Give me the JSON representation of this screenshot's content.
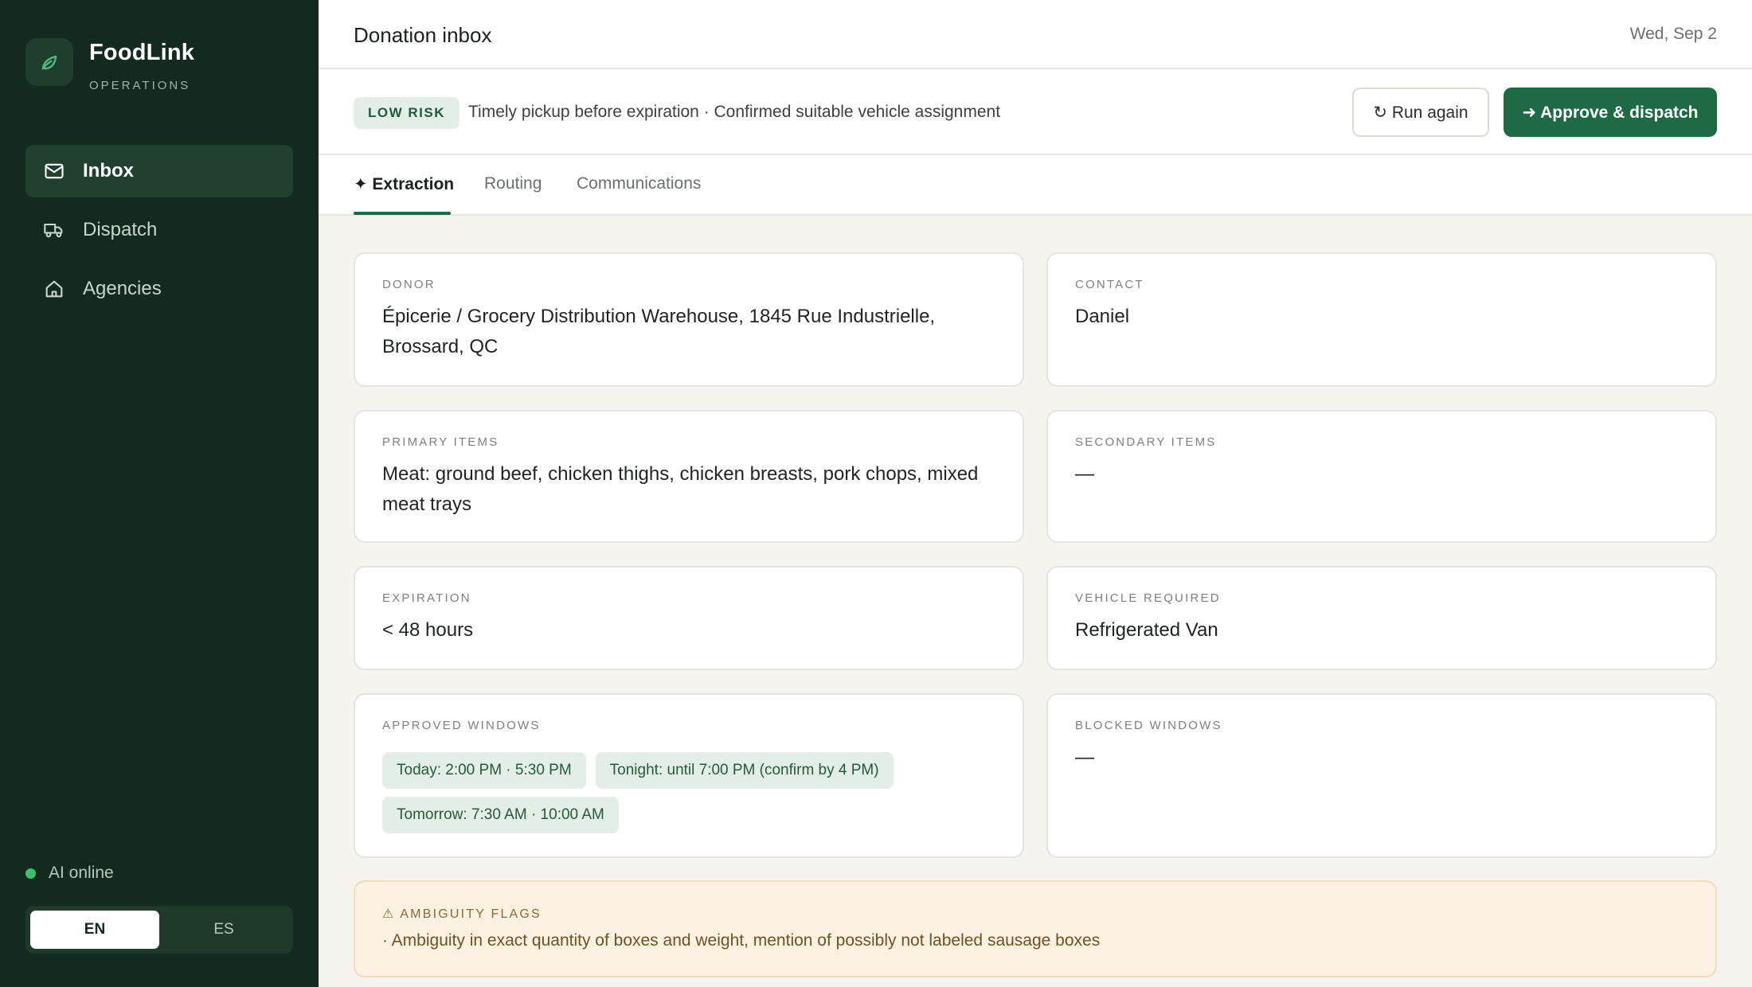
{
  "brand": {
    "name": "FoodLink",
    "subtitle": "OPERATIONS"
  },
  "sidebar": {
    "items": [
      {
        "label": "Inbox",
        "icon": "mail-icon",
        "active": true
      },
      {
        "label": "Dispatch",
        "icon": "truck-icon",
        "active": false
      },
      {
        "label": "Agencies",
        "icon": "home-icon",
        "active": false
      }
    ],
    "ai_status": "AI online",
    "languages": [
      "EN",
      "ES"
    ],
    "selected_language": "EN"
  },
  "header": {
    "title": "Donation inbox",
    "date": "Wed, Sep 2"
  },
  "risk": {
    "badge": "LOW RISK",
    "summary": "Timely pickup before expiration · Confirmed suitable vehicle assignment",
    "run_again_label": "↻ Run again",
    "approve_label": "➜ Approve & dispatch"
  },
  "tabs": [
    {
      "label": "✦ Extraction",
      "active": true
    },
    {
      "label": "Routing",
      "active": false
    },
    {
      "label": "Communications",
      "active": false
    }
  ],
  "fields": {
    "donor": {
      "label": "DONOR",
      "value": "Épicerie / Grocery Distribution Warehouse, 1845 Rue Industrielle, Brossard, QC"
    },
    "contact": {
      "label": "CONTACT",
      "value": "Daniel"
    },
    "primary_items": {
      "label": "PRIMARY ITEMS",
      "value": "Meat: ground beef, chicken thighs, chicken breasts, pork chops, mixed meat trays"
    },
    "secondary_items": {
      "label": "SECONDARY ITEMS",
      "value": "—"
    },
    "expiration": {
      "label": "EXPIRATION",
      "value": "< 48 hours"
    },
    "vehicle": {
      "label": "VEHICLE REQUIRED",
      "value": "Refrigerated Van"
    },
    "approved_windows": {
      "label": "APPROVED WINDOWS",
      "items": [
        "Today: 2:00 PM · 5:30 PM",
        "Tonight: until 7:00 PM (confirm by 4 PM)",
        "Tomorrow: 7:30 AM · 10:00 AM"
      ]
    },
    "blocked_windows": {
      "label": "BLOCKED WINDOWS",
      "value": "—"
    }
  },
  "ambiguity": {
    "title": "⚠ AMBIGUITY FLAGS",
    "text": "· Ambiguity in exact quantity of boxes and weight, mention of possibly not labeled sausage boxes"
  },
  "colors": {
    "sidebar_bg": "#132a1e",
    "accent": "#1d6a45",
    "chip_bg": "#e3efe6",
    "flag_bg": "#fdf1e2"
  }
}
